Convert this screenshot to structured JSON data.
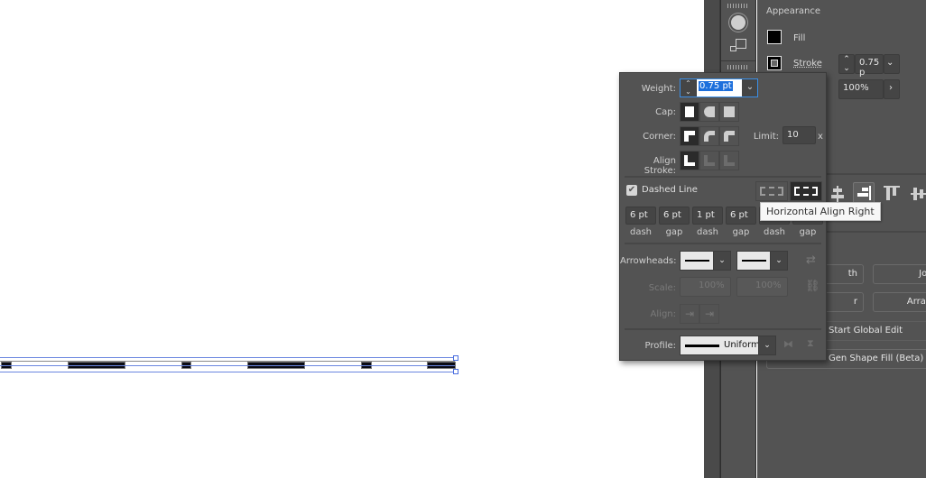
{
  "canvas": {
    "dashes": [
      "dash",
      "dash",
      "dash",
      "dash",
      "dash",
      "dash"
    ]
  },
  "appearance": {
    "title": "Appearance",
    "fill_label": "Fill",
    "stroke_label": "Stroke",
    "stroke_weight": "0.75 p",
    "opacity": "100%",
    "buttons": {
      "path_partial": "th",
      "join_partial": "Joi",
      "or_partial": "r",
      "arrange_partial": "Arrar",
      "start_global_edit": "Start Global Edit",
      "gen_shape_fill": "Gen Shape Fill (Beta)"
    }
  },
  "stroke_panel": {
    "weight_label": "Weight:",
    "weight_value": "0.75 pt",
    "cap_label": "Cap:",
    "corner_label": "Corner:",
    "limit_label": "Limit:",
    "limit_value": "10",
    "limit_unit": "x",
    "align_stroke_label": "Align Stroke:",
    "dashed_line_label": "Dashed Line",
    "dashed_line_checked": true,
    "dash_gap": [
      {
        "value": "6 pt",
        "label": "dash"
      },
      {
        "value": "6 pt",
        "label": "gap"
      },
      {
        "value": "1 pt",
        "label": "dash"
      },
      {
        "value": "6 pt",
        "label": "gap"
      },
      {
        "value": "",
        "label": "dash"
      },
      {
        "value": "",
        "label": "gap"
      }
    ],
    "arrowheads_label": "Arrowheads:",
    "scale_label": "Scale:",
    "scale_start": "100%",
    "scale_end": "100%",
    "align_label": "Align:",
    "profile_label": "Profile:",
    "profile_value": "Uniform"
  },
  "tooltip": "Horizontal Align Right"
}
